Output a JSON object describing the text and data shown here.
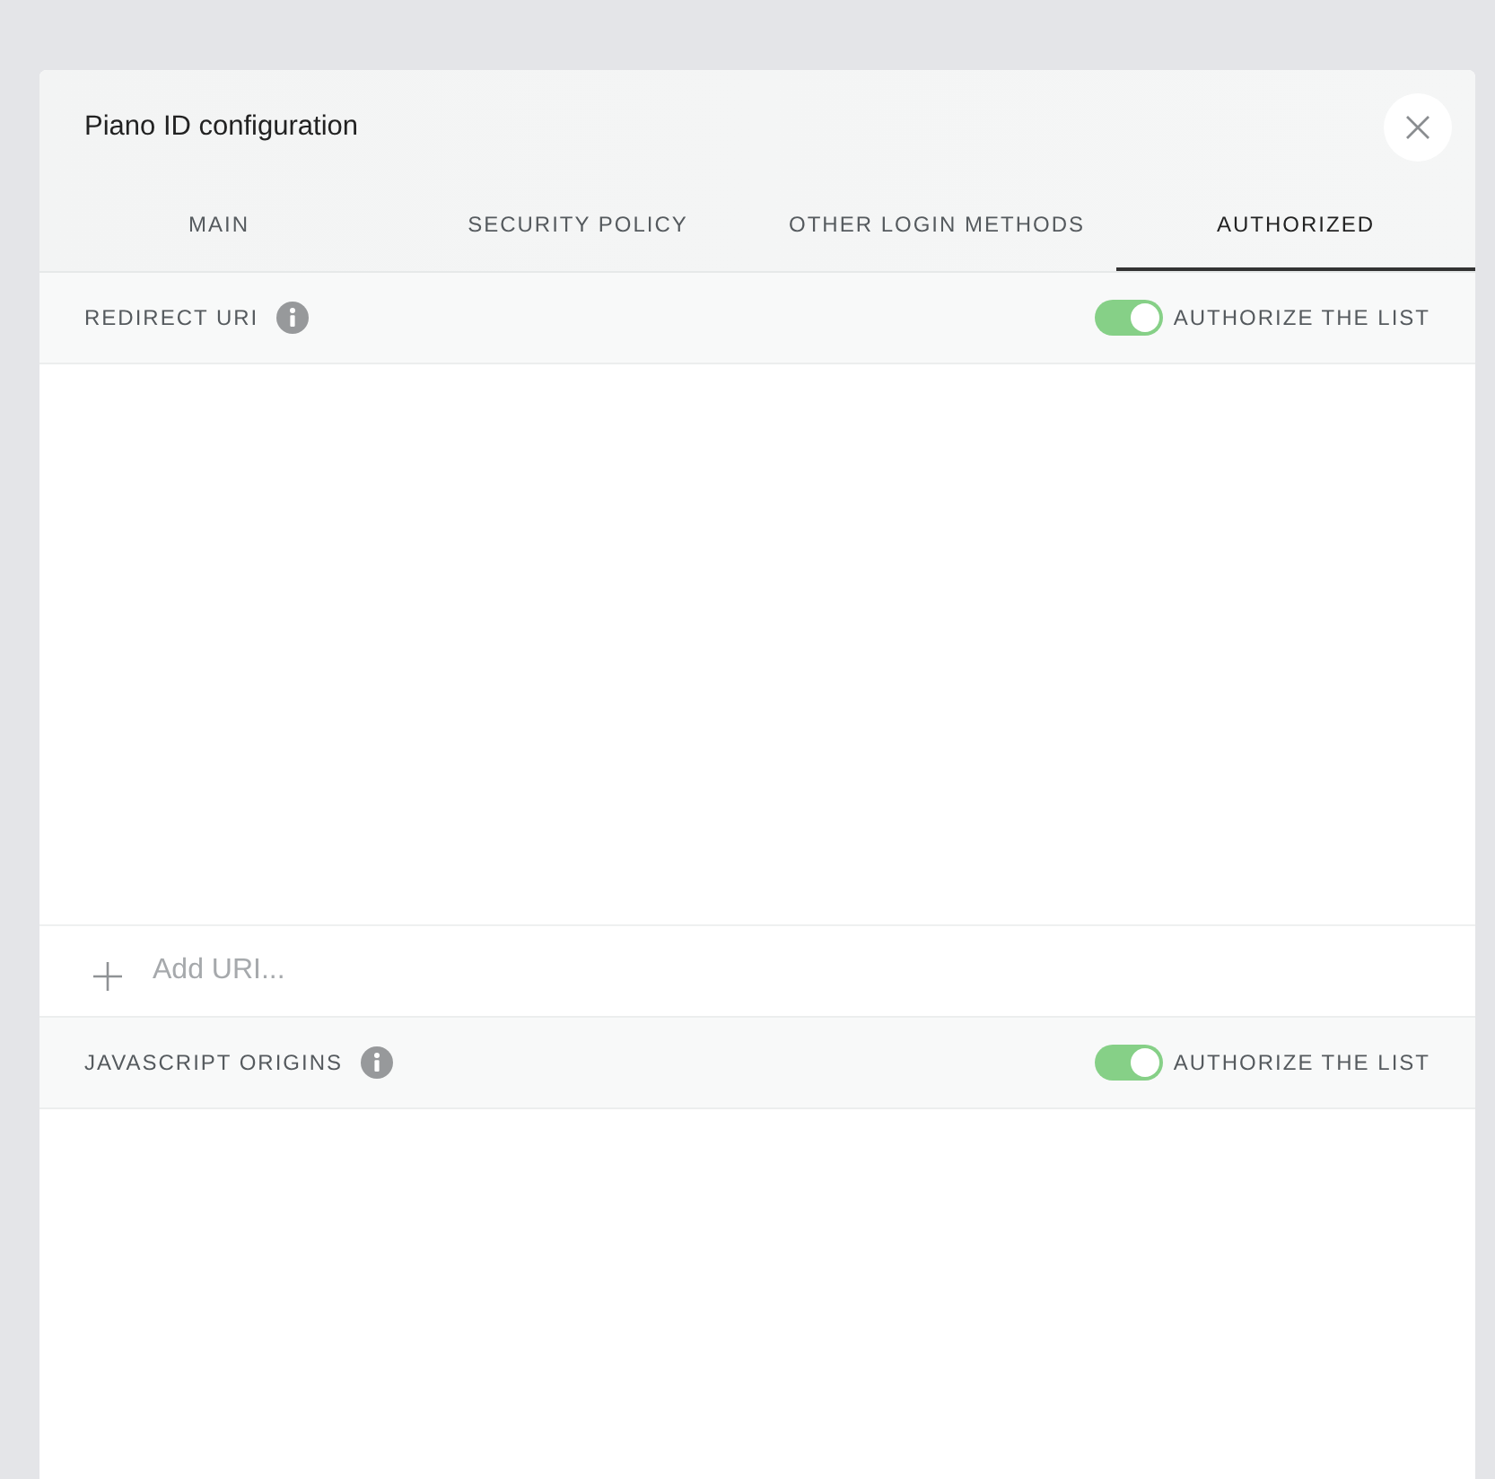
{
  "dialog": {
    "title": "Piano ID configuration"
  },
  "tabs": [
    {
      "label": "MAIN",
      "selected": false
    },
    {
      "label": "SECURITY POLICY",
      "selected": false
    },
    {
      "label": "OTHER LOGIN METHODS",
      "selected": false
    },
    {
      "label": "AUTHORIZED",
      "selected": true
    }
  ],
  "sections": [
    {
      "title": "REDIRECT URI",
      "toggle": {
        "label": "AUTHORIZE THE LIST",
        "on": true
      },
      "add_field": {
        "placeholder": "Add URI..."
      }
    },
    {
      "title": "JAVASCRIPT ORIGINS",
      "toggle": {
        "label": "AUTHORIZE THE LIST",
        "on": true
      }
    }
  ]
}
